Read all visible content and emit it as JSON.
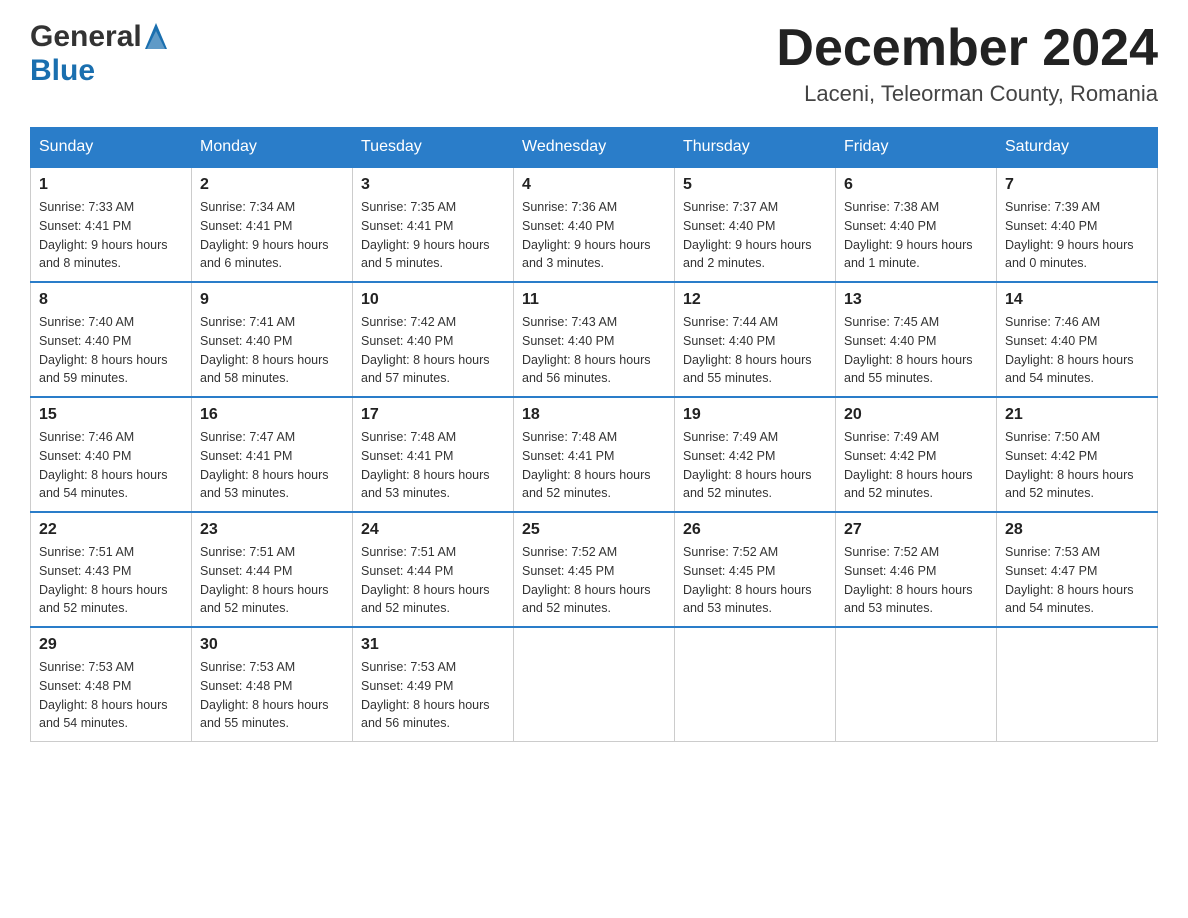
{
  "header": {
    "logo_general": "General",
    "logo_blue": "Blue",
    "month_title": "December 2024",
    "location": "Laceni, Teleorman County, Romania"
  },
  "weekdays": [
    "Sunday",
    "Monday",
    "Tuesday",
    "Wednesday",
    "Thursday",
    "Friday",
    "Saturday"
  ],
  "weeks": [
    [
      {
        "day": "1",
        "sunrise": "7:33 AM",
        "sunset": "4:41 PM",
        "daylight": "9 hours and 8 minutes."
      },
      {
        "day": "2",
        "sunrise": "7:34 AM",
        "sunset": "4:41 PM",
        "daylight": "9 hours and 6 minutes."
      },
      {
        "day": "3",
        "sunrise": "7:35 AM",
        "sunset": "4:41 PM",
        "daylight": "9 hours and 5 minutes."
      },
      {
        "day": "4",
        "sunrise": "7:36 AM",
        "sunset": "4:40 PM",
        "daylight": "9 hours and 3 minutes."
      },
      {
        "day": "5",
        "sunrise": "7:37 AM",
        "sunset": "4:40 PM",
        "daylight": "9 hours and 2 minutes."
      },
      {
        "day": "6",
        "sunrise": "7:38 AM",
        "sunset": "4:40 PM",
        "daylight": "9 hours and 1 minute."
      },
      {
        "day": "7",
        "sunrise": "7:39 AM",
        "sunset": "4:40 PM",
        "daylight": "9 hours and 0 minutes."
      }
    ],
    [
      {
        "day": "8",
        "sunrise": "7:40 AM",
        "sunset": "4:40 PM",
        "daylight": "8 hours and 59 minutes."
      },
      {
        "day": "9",
        "sunrise": "7:41 AM",
        "sunset": "4:40 PM",
        "daylight": "8 hours and 58 minutes."
      },
      {
        "day": "10",
        "sunrise": "7:42 AM",
        "sunset": "4:40 PM",
        "daylight": "8 hours and 57 minutes."
      },
      {
        "day": "11",
        "sunrise": "7:43 AM",
        "sunset": "4:40 PM",
        "daylight": "8 hours and 56 minutes."
      },
      {
        "day": "12",
        "sunrise": "7:44 AM",
        "sunset": "4:40 PM",
        "daylight": "8 hours and 55 minutes."
      },
      {
        "day": "13",
        "sunrise": "7:45 AM",
        "sunset": "4:40 PM",
        "daylight": "8 hours and 55 minutes."
      },
      {
        "day": "14",
        "sunrise": "7:46 AM",
        "sunset": "4:40 PM",
        "daylight": "8 hours and 54 minutes."
      }
    ],
    [
      {
        "day": "15",
        "sunrise": "7:46 AM",
        "sunset": "4:40 PM",
        "daylight": "8 hours and 54 minutes."
      },
      {
        "day": "16",
        "sunrise": "7:47 AM",
        "sunset": "4:41 PM",
        "daylight": "8 hours and 53 minutes."
      },
      {
        "day": "17",
        "sunrise": "7:48 AM",
        "sunset": "4:41 PM",
        "daylight": "8 hours and 53 minutes."
      },
      {
        "day": "18",
        "sunrise": "7:48 AM",
        "sunset": "4:41 PM",
        "daylight": "8 hours and 52 minutes."
      },
      {
        "day": "19",
        "sunrise": "7:49 AM",
        "sunset": "4:42 PM",
        "daylight": "8 hours and 52 minutes."
      },
      {
        "day": "20",
        "sunrise": "7:49 AM",
        "sunset": "4:42 PM",
        "daylight": "8 hours and 52 minutes."
      },
      {
        "day": "21",
        "sunrise": "7:50 AM",
        "sunset": "4:42 PM",
        "daylight": "8 hours and 52 minutes."
      }
    ],
    [
      {
        "day": "22",
        "sunrise": "7:51 AM",
        "sunset": "4:43 PM",
        "daylight": "8 hours and 52 minutes."
      },
      {
        "day": "23",
        "sunrise": "7:51 AM",
        "sunset": "4:44 PM",
        "daylight": "8 hours and 52 minutes."
      },
      {
        "day": "24",
        "sunrise": "7:51 AM",
        "sunset": "4:44 PM",
        "daylight": "8 hours and 52 minutes."
      },
      {
        "day": "25",
        "sunrise": "7:52 AM",
        "sunset": "4:45 PM",
        "daylight": "8 hours and 52 minutes."
      },
      {
        "day": "26",
        "sunrise": "7:52 AM",
        "sunset": "4:45 PM",
        "daylight": "8 hours and 53 minutes."
      },
      {
        "day": "27",
        "sunrise": "7:52 AM",
        "sunset": "4:46 PM",
        "daylight": "8 hours and 53 minutes."
      },
      {
        "day": "28",
        "sunrise": "7:53 AM",
        "sunset": "4:47 PM",
        "daylight": "8 hours and 54 minutes."
      }
    ],
    [
      {
        "day": "29",
        "sunrise": "7:53 AM",
        "sunset": "4:48 PM",
        "daylight": "8 hours and 54 minutes."
      },
      {
        "day": "30",
        "sunrise": "7:53 AM",
        "sunset": "4:48 PM",
        "daylight": "8 hours and 55 minutes."
      },
      {
        "day": "31",
        "sunrise": "7:53 AM",
        "sunset": "4:49 PM",
        "daylight": "8 hours and 56 minutes."
      },
      null,
      null,
      null,
      null
    ]
  ],
  "labels": {
    "sunrise": "Sunrise:",
    "sunset": "Sunset:",
    "daylight": "Daylight:"
  }
}
